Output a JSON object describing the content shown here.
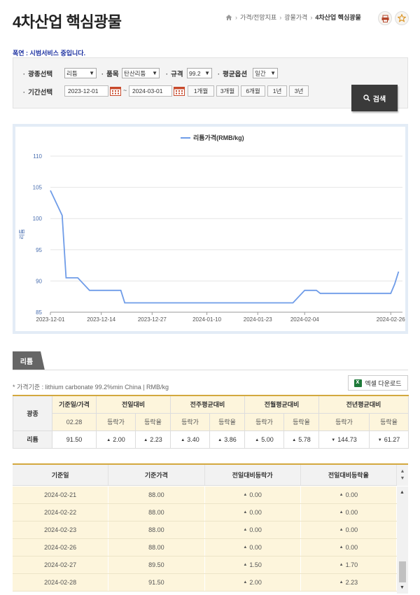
{
  "header": {
    "title": "4차산업 핵심광물",
    "breadcrumb": [
      "가격/전망지표",
      "광물가격",
      "4차산업 핵심광물"
    ]
  },
  "notice": "폭연 : 시범서비스 중입니다.",
  "search": {
    "mineral_label": "광종선택",
    "mineral_value": "리튬",
    "item_label": "품목",
    "item_value": "탄산리튬",
    "spec_label": "규격",
    "spec_value": "99.2",
    "avg_label": "평균옵션",
    "avg_value": "일간",
    "period_label": "기간선택",
    "date_from": "2023-12-01",
    "date_to": "2024-03-01",
    "tilde": "~",
    "period_buttons": [
      "1개월",
      "3개월",
      "6개월",
      "1년",
      "3년"
    ],
    "search_button": "검색"
  },
  "chart_data": {
    "type": "line",
    "legend": "리튬가격(RMB/kg)",
    "ylabel": "리튬",
    "ylim": [
      85,
      110
    ],
    "yticks": [
      85,
      90,
      95,
      100,
      105,
      110
    ],
    "xticks": [
      "2023-12-01",
      "2023-12-14",
      "2023-12-27",
      "2024-01-10",
      "2024-01-23",
      "2024-02-04",
      "2024-02-26"
    ],
    "series": [
      {
        "name": "리튬가격(RMB/kg)",
        "color": "#6f9ce8",
        "points": [
          [
            "2023-12-01",
            104.5
          ],
          [
            "2023-12-04",
            100.5
          ],
          [
            "2023-12-05",
            90.5
          ],
          [
            "2023-12-08",
            90.5
          ],
          [
            "2023-12-11",
            88.5
          ],
          [
            "2023-12-14",
            88.5
          ],
          [
            "2023-12-19",
            88.5
          ],
          [
            "2023-12-20",
            86.5
          ],
          [
            "2024-02-01",
            86.5
          ],
          [
            "2024-02-04",
            88.5
          ],
          [
            "2024-02-07",
            88.5
          ],
          [
            "2024-02-08",
            88.0
          ],
          [
            "2024-02-26",
            88.0
          ],
          [
            "2024-02-27",
            89.5
          ],
          [
            "2024-02-28",
            91.5
          ]
        ]
      }
    ]
  },
  "tabs": {
    "active": "리튬"
  },
  "price_basis": "* 가격기준 : lithium carbonate 99.2%min China  |  RMB/kg",
  "excel_button": "엑셀 다운로드",
  "summary": {
    "col_mineral": "광종",
    "col_date_price": "기준일/가격",
    "groups": [
      "전일대비",
      "전주평균대비",
      "전월평균대비",
      "전년평균대비"
    ],
    "sub_labels": [
      "등락가",
      "등락율"
    ],
    "date": "02.28",
    "mineral": "리튬",
    "price": "91.50",
    "values": [
      {
        "value": "2.00",
        "dir": "up"
      },
      {
        "value": "2.23",
        "dir": "up"
      },
      {
        "value": "3.40",
        "dir": "up"
      },
      {
        "value": "3.86",
        "dir": "up"
      },
      {
        "value": "5.00",
        "dir": "up"
      },
      {
        "value": "5.78",
        "dir": "up"
      },
      {
        "value": "144.73",
        "dir": "down"
      },
      {
        "value": "61.27",
        "dir": "down"
      }
    ]
  },
  "detail": {
    "headers": [
      "기준일",
      "기준가격",
      "전일대비등락가",
      "전일대비등락율"
    ],
    "rows": [
      {
        "date": "2024-02-21",
        "price": "88.00",
        "chg": "0.00",
        "rate": "0.00"
      },
      {
        "date": "2024-02-22",
        "price": "88.00",
        "chg": "0.00",
        "rate": "0.00"
      },
      {
        "date": "2024-02-23",
        "price": "88.00",
        "chg": "0.00",
        "rate": "0.00"
      },
      {
        "date": "2024-02-26",
        "price": "88.00",
        "chg": "0.00",
        "rate": "0.00"
      },
      {
        "date": "2024-02-27",
        "price": "89.50",
        "chg": "1.50",
        "rate": "1.70"
      },
      {
        "date": "2024-02-28",
        "price": "91.50",
        "chg": "2.00",
        "rate": "2.23"
      }
    ]
  }
}
